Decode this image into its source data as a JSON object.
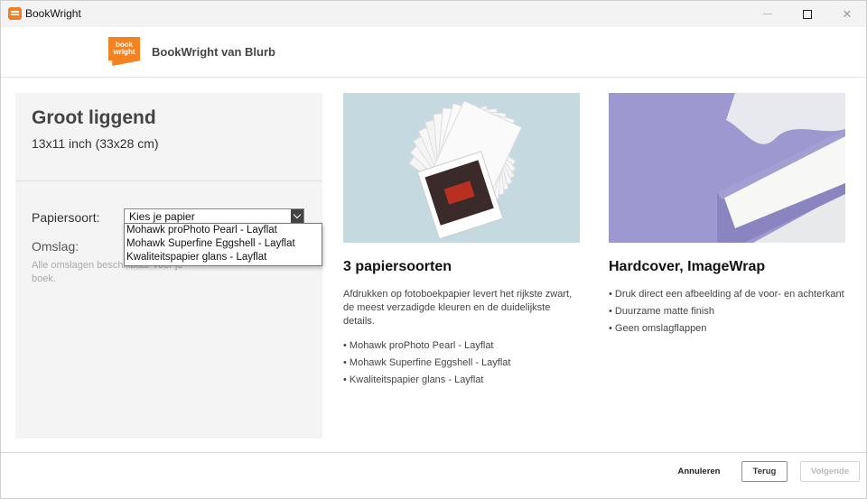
{
  "window": {
    "title": "BookWright",
    "icons": {
      "app": "bookwright-app-icon",
      "minimize": "minimize-icon",
      "maximize": "maximize-icon",
      "close": "close-icon"
    }
  },
  "header": {
    "logo_text_line1": "book",
    "logo_text_line2": "wright",
    "brand": "BookWright van Blurb"
  },
  "format": {
    "title": "Groot liggend",
    "size": "13x11 inch (33x28 cm)"
  },
  "paper": {
    "label": "Papiersoort:",
    "select_value": "Kies je papier",
    "options": [
      "Mohawk proPhoto Pearl - Layflat",
      "Mohawk Superfine Eggshell - Layflat",
      "Kwaliteitspapier glans - Layflat"
    ]
  },
  "cover": {
    "label": "Omslag:",
    "description": "Alle omslagen beschikbaar voor je boek."
  },
  "features": {
    "paper": {
      "title": "3 papiersoorten",
      "description": "Afdrukken op fotoboekpapier levert het rijkste zwart, de meest verzadigde kleuren en de duidelijkste details.",
      "bullets": [
        "• Mohawk proPhoto Pearl - Layflat",
        "• Mohawk Superfine Eggshell - Layflat",
        "• Kwaliteitspapier glans - Layflat"
      ]
    },
    "cover": {
      "title": "Hardcover, ImageWrap",
      "bullets": [
        "• Druk direct een afbeelding af de voor- en achterkant",
        "• Duurzame matte finish",
        "• Geen omslagflappen"
      ]
    }
  },
  "footer": {
    "cancel": "Annuleren",
    "back": "Terug",
    "next": "Volgende"
  }
}
